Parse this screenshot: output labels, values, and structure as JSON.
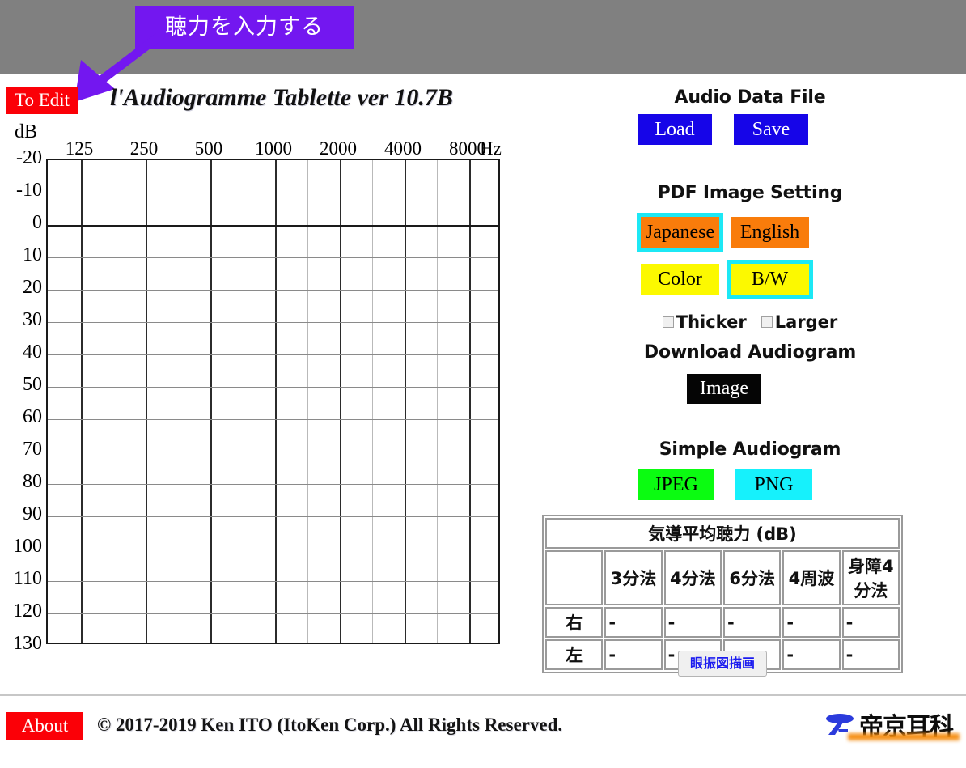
{
  "callout": {
    "text": "聴力を入力する",
    "color": "#7317f0"
  },
  "header": {
    "to_edit_label": "To Edit",
    "title": "l'Audiogramme Tablette ver 10.7B"
  },
  "chart_data": {
    "type": "line",
    "title": "Audiogram",
    "xlabel": "Hz",
    "ylabel": "dB",
    "grid": true,
    "legend": "none",
    "x_unit": "Hz",
    "y_unit": "dB",
    "categories": [
      "125",
      "250",
      "500",
      "1000",
      "2000",
      "4000",
      "8000"
    ],
    "x_tick_labels": [
      "125",
      "250",
      "500",
      "1000",
      "2000",
      "4000",
      "8000"
    ],
    "y_tick_labels": [
      "-20",
      "-10",
      "0",
      "10",
      "20",
      "30",
      "40",
      "50",
      "60",
      "70",
      "80",
      "90",
      "100",
      "110",
      "120",
      "130"
    ],
    "ylim": [
      -20,
      130
    ],
    "y_inverted": true,
    "minor_x_ticks": [
      "750",
      "1500",
      "3000",
      "6000"
    ],
    "series": [],
    "values": []
  },
  "right_panel": {
    "audio_file": {
      "heading": "Audio Data File",
      "load_label": "Load",
      "save_label": "Save",
      "button_color": "#1605e8"
    },
    "pdf_setting": {
      "heading": "PDF Image Setting",
      "language_options": [
        "Japanese",
        "English"
      ],
      "language_selected": "Japanese",
      "language_color": "#f97c0b",
      "mode_options": [
        "Color",
        "B/W"
      ],
      "mode_selected": "B/W",
      "mode_color": "#fcf900",
      "selection_ring_color": "#1ce8f5",
      "checkboxes": [
        {
          "label": "Thicker",
          "checked": false
        },
        {
          "label": "Larger",
          "checked": false
        }
      ]
    },
    "download": {
      "heading": "Download Audiogram",
      "image_label": "Image",
      "button_color": "#050505"
    },
    "simple": {
      "heading": "Simple Audiogram",
      "jpeg_label": "JPEG",
      "jpeg_color": "#0bfc11",
      "png_label": "PNG",
      "png_color": "#16f1fc"
    },
    "avg_table": {
      "title": "気導平均聴力 (dB)",
      "corner": "",
      "columns": [
        "3分法",
        "4分法",
        "6分法",
        "4周波",
        "身障4分法"
      ],
      "rows": [
        {
          "side": "右",
          "values": [
            "-",
            "-",
            "-",
            "-",
            "-"
          ]
        },
        {
          "side": "左",
          "values": [
            "-",
            "-",
            "-",
            "-",
            "-"
          ]
        }
      ]
    },
    "nystagmus_label": "眼振図描画"
  },
  "footer": {
    "about_label": "About",
    "copyright": "© 2017-2019 Ken ITO (ItoKen Corp.) All Rights Reserved.",
    "brand_name": "帝京耳科"
  }
}
